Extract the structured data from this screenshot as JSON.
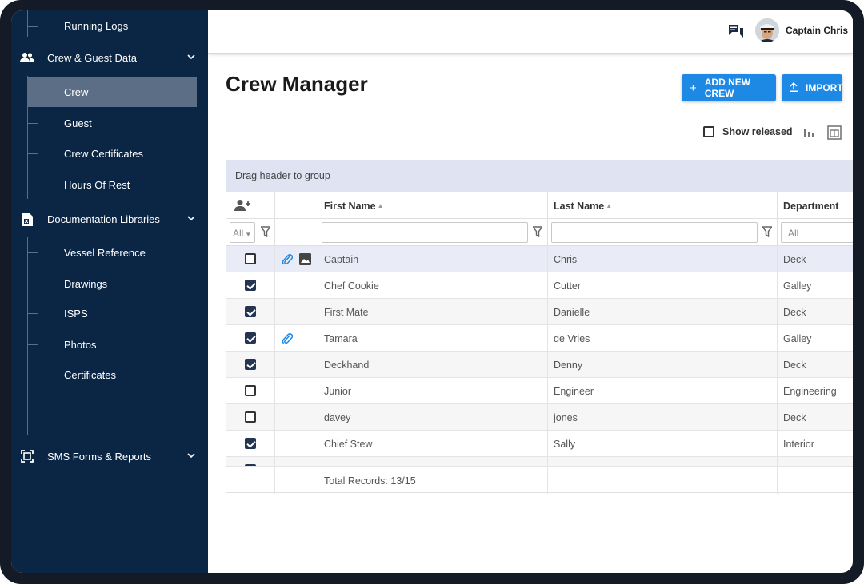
{
  "sidebar": {
    "items": [
      {
        "label": "Running Logs",
        "type": "child"
      },
      {
        "label": "Crew & Guest Data",
        "type": "section",
        "icon": "people-icon"
      },
      {
        "label": "Crew",
        "type": "child",
        "active": true
      },
      {
        "label": "Guest",
        "type": "child"
      },
      {
        "label": "Crew Certificates",
        "type": "child"
      },
      {
        "label": "Hours Of Rest",
        "type": "child"
      },
      {
        "label": "Documentation Libraries",
        "type": "section",
        "icon": "document-icon"
      },
      {
        "label": "Vessel Reference",
        "type": "child"
      },
      {
        "label": "Drawings",
        "type": "child"
      },
      {
        "label": "ISPS",
        "type": "child"
      },
      {
        "label": "Photos",
        "type": "child"
      },
      {
        "label": "Certificates",
        "type": "child"
      },
      {
        "label": "SMS Forms & Reports",
        "type": "section",
        "icon": "scan-icon"
      }
    ]
  },
  "header": {
    "user_name": "Captain Chris"
  },
  "main": {
    "title": "Crew Manager",
    "add_button": "ADD NEW CREW",
    "import_button": "IMPORT",
    "show_released": "Show released",
    "show_released_checked": false
  },
  "grid": {
    "group_bar": "Drag header to group",
    "columns": [
      "First Name",
      "Last Name",
      "Department"
    ],
    "filter_all_select": "All",
    "filter_department_placeholder": "All",
    "rows": [
      {
        "checked": false,
        "attachment": true,
        "image": true,
        "first": "Captain",
        "last": "Chris",
        "dept": "Deck"
      },
      {
        "checked": true,
        "attachment": false,
        "image": false,
        "first": "Chef Cookie",
        "last": "Cutter",
        "dept": "Galley"
      },
      {
        "checked": true,
        "attachment": false,
        "image": false,
        "first": "First Mate",
        "last": "Danielle",
        "dept": "Deck"
      },
      {
        "checked": true,
        "attachment": true,
        "image": false,
        "first": "Tamara",
        "last": "de Vries",
        "dept": "Galley"
      },
      {
        "checked": true,
        "attachment": false,
        "image": false,
        "first": "Deckhand",
        "last": "Denny",
        "dept": "Deck"
      },
      {
        "checked": false,
        "attachment": false,
        "image": false,
        "first": "Junior",
        "last": "Engineer",
        "dept": "Engineering"
      },
      {
        "checked": false,
        "attachment": false,
        "image": false,
        "first": "davey",
        "last": "jones",
        "dept": "Deck"
      },
      {
        "checked": true,
        "attachment": false,
        "image": false,
        "first": "Chief Stew",
        "last": "Sally",
        "dept": "Interior"
      }
    ],
    "total_records": "Total Records: 13/15"
  },
  "colors": {
    "sidebar_bg": "#0b2645",
    "active_item": "#5c6e86",
    "accent": "#1e88e5",
    "group_bar": "#dfe3f2"
  }
}
